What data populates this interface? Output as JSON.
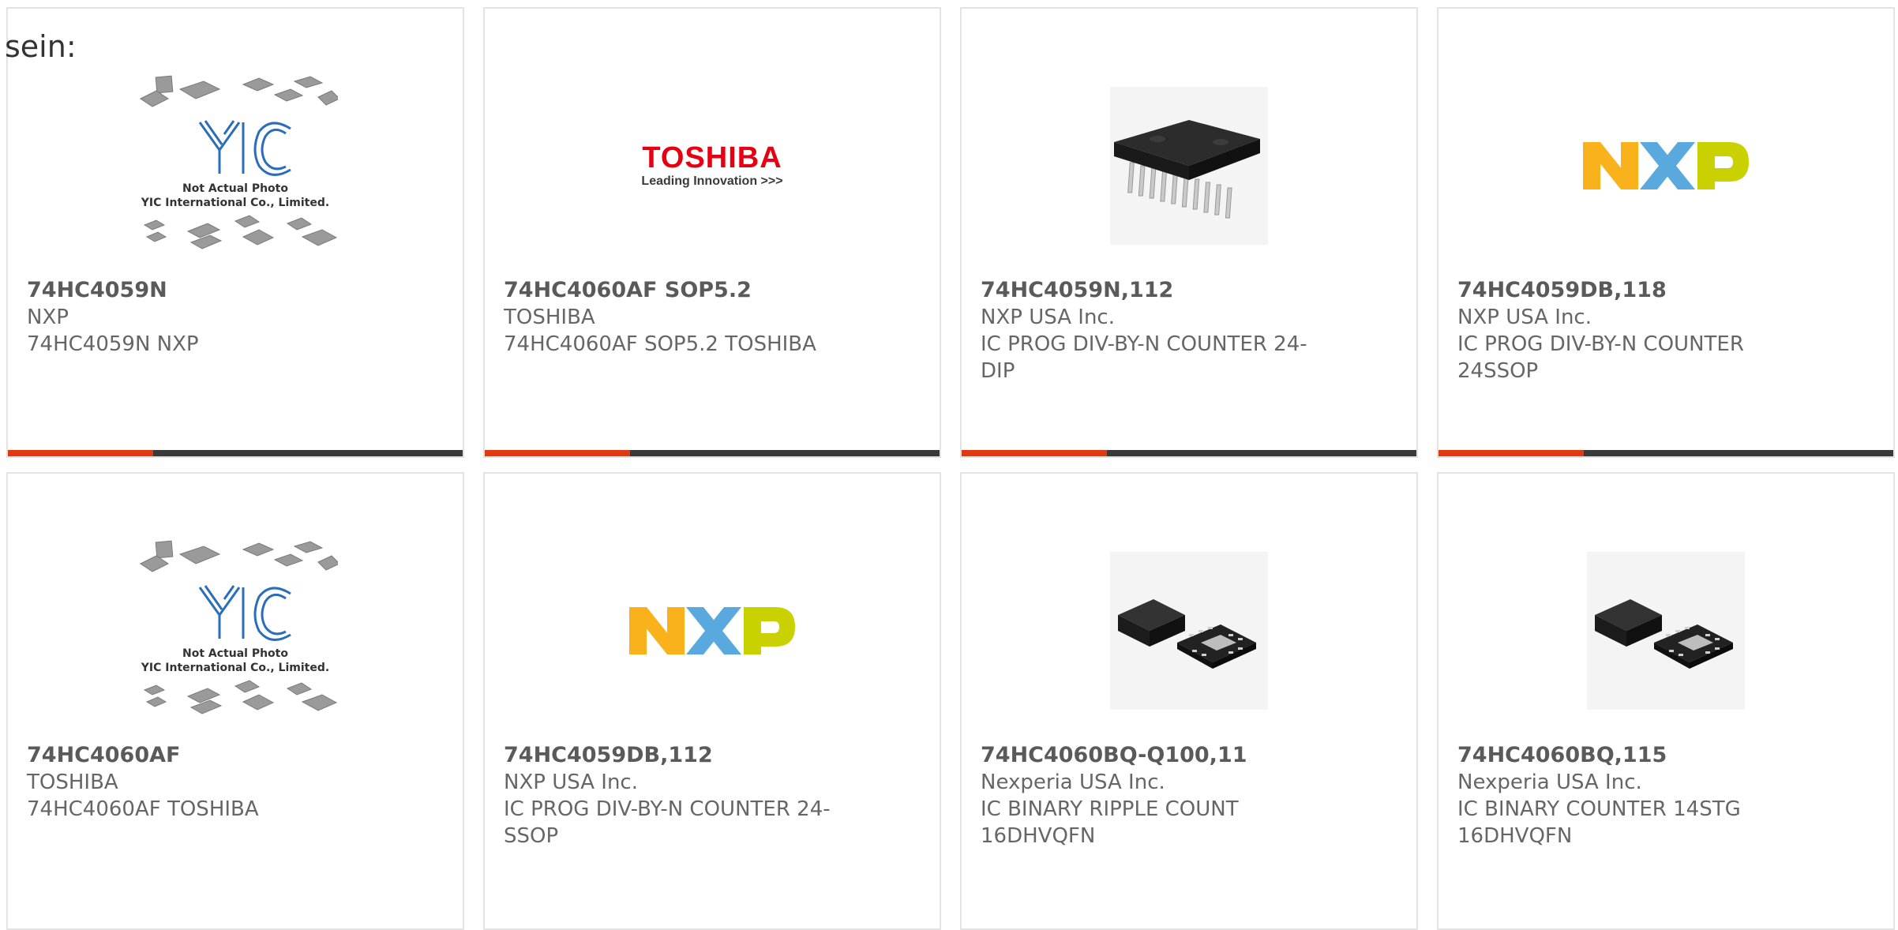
{
  "page": {
    "intro_text": "sein:"
  },
  "products": [
    {
      "part_number": "74HC4059N",
      "manufacturer": "NXP",
      "description": "74HC4059N NXP",
      "image": "placeholder-photo",
      "placeholder_caption_1": "Not Actual Photo",
      "placeholder_caption_2": "YIC International Co., Limited."
    },
    {
      "part_number": "74HC4060AF SOP5.2",
      "manufacturer": "TOSHIBA",
      "description": "74HC4060AF SOP5.2 TOSHIBA",
      "image": "toshiba-logo",
      "logo_text": "TOSHIBA",
      "logo_tagline": "Leading Innovation >>>"
    },
    {
      "part_number": "74HC4059N,112",
      "manufacturer": "NXP USA Inc.",
      "description": "IC PROG DIV-BY-N COUNTER 24-DIP",
      "image": "dip-chip-photo"
    },
    {
      "part_number": "74HC4059DB,118",
      "manufacturer": "NXP USA Inc.",
      "description": "IC PROG DIV-BY-N COUNTER 24SSOP",
      "image": "nxp-logo"
    },
    {
      "part_number": "74HC4060AF",
      "manufacturer": "TOSHIBA",
      "description": "74HC4060AF TOSHIBA",
      "image": "placeholder-photo",
      "placeholder_caption_1": "Not Actual Photo",
      "placeholder_caption_2": "YIC International Co., Limited."
    },
    {
      "part_number": "74HC4059DB,112",
      "manufacturer": "NXP USA Inc.",
      "description": "IC PROG DIV-BY-N COUNTER 24-SSOP",
      "image": "nxp-logo"
    },
    {
      "part_number": "74HC4060BQ-Q100,11",
      "manufacturer": "Nexperia USA Inc.",
      "description": "IC BINARY RIPPLE COUNT 16DHVQFN",
      "image": "qfn-chip-photo"
    },
    {
      "part_number": "74HC4060BQ,115",
      "manufacturer": "Nexperia USA Inc.",
      "description": "IC BINARY COUNTER 14STG 16DHVQFN",
      "image": "qfn-chip-photo"
    }
  ],
  "colors": {
    "accent_bar": "#e23a10",
    "dark_bar": "#3a3a3a",
    "card_border": "#e3e3e3",
    "nxp_orange": "#f9b21c",
    "nxp_blue": "#5aa9de",
    "nxp_green": "#c9d200",
    "toshiba_red": "#e60012"
  }
}
